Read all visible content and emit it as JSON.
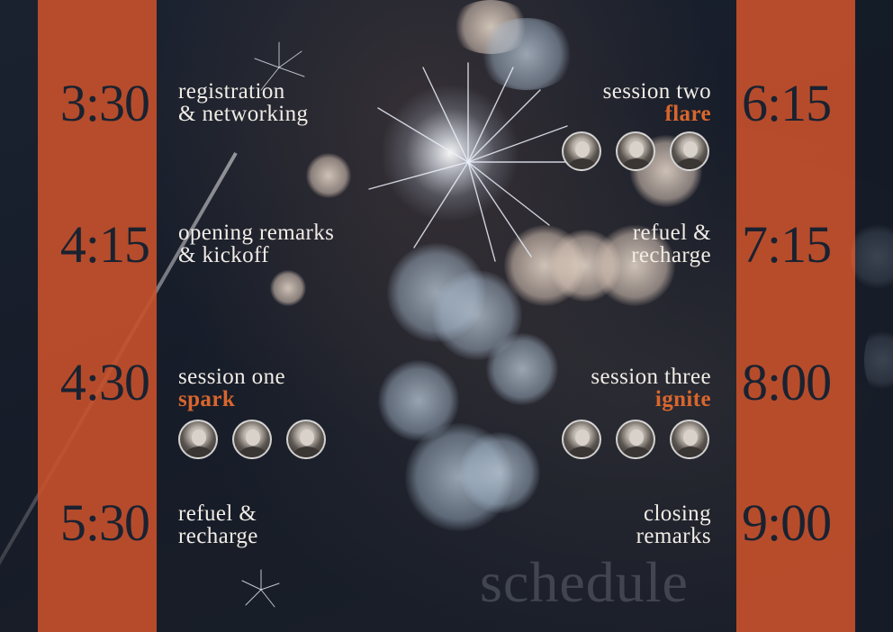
{
  "colors": {
    "accent": "#d9662d",
    "column": "#c8512b",
    "background": "#141b26",
    "text": "#f1ece6",
    "time_text": "#1a2230"
  },
  "schedule": {
    "left": [
      {
        "time": "3:30",
        "lines": [
          "registration",
          "& networking"
        ],
        "accent": ""
      },
      {
        "time": "4:15",
        "lines": [
          "opening remarks",
          "& kickoff"
        ],
        "accent": ""
      },
      {
        "time": "4:30",
        "lines": [
          "session one"
        ],
        "accent": "spark",
        "speakers": [
          "speaker-1",
          "speaker-2",
          "speaker-3"
        ]
      },
      {
        "time": "5:30",
        "lines": [
          "refuel &",
          "recharge"
        ],
        "accent": ""
      }
    ],
    "right": [
      {
        "time": "6:15",
        "lines": [
          "session two"
        ],
        "accent": "flare",
        "speakers": [
          "speaker-4",
          "speaker-5",
          "speaker-6"
        ]
      },
      {
        "time": "7:15",
        "lines": [
          "refuel &",
          "recharge"
        ],
        "accent": ""
      },
      {
        "time": "8:00",
        "lines": [
          "session three"
        ],
        "accent": "ignite",
        "speakers": [
          "speaker-7",
          "speaker-8",
          "speaker-9"
        ]
      },
      {
        "time": "9:00",
        "lines": [
          "closing",
          "remarks"
        ],
        "accent": ""
      }
    ]
  },
  "watermark": "schedule"
}
